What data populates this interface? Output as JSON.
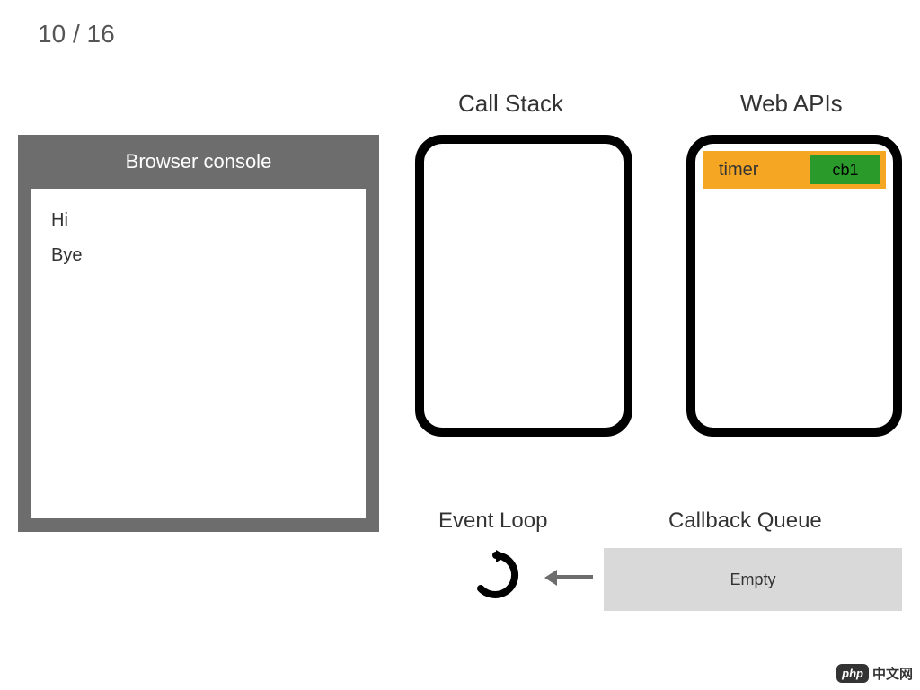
{
  "page": {
    "current": 10,
    "total": 16
  },
  "console": {
    "title": "Browser console",
    "lines": [
      "Hi",
      "Bye"
    ]
  },
  "callstack": {
    "title": "Call Stack",
    "items": []
  },
  "webapis": {
    "title": "Web APIs",
    "entries": [
      {
        "label": "timer",
        "callback": "cb1"
      }
    ]
  },
  "eventloop": {
    "title": "Event Loop"
  },
  "callback_queue": {
    "title": "Callback Queue",
    "content": "Empty"
  },
  "watermark": {
    "badge": "php",
    "text": "中文网"
  },
  "colors": {
    "panel_grey": "#6d6d6d",
    "timer_bg": "#f5a623",
    "cb_bg": "#2a9b2a",
    "queue_bg": "#d9d9d9"
  }
}
